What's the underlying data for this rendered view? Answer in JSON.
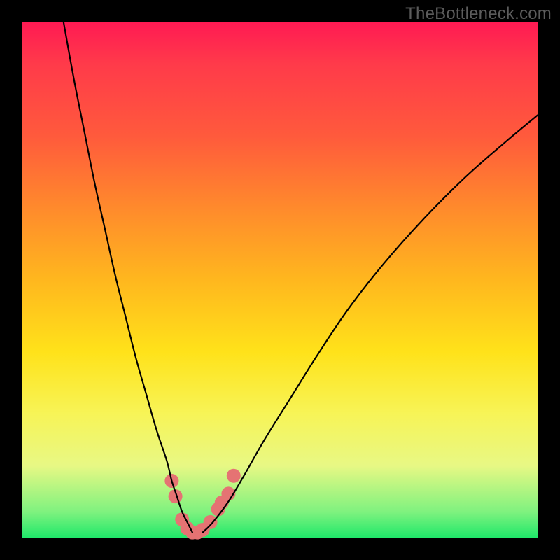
{
  "watermark": "TheBottleneck.com",
  "colors": {
    "background": "#000000",
    "curve_stroke": "#000000",
    "marker_fill": "#e57373"
  },
  "chart_data": {
    "type": "line",
    "title": "",
    "xlabel": "",
    "ylabel": "",
    "xlim": [
      0,
      100
    ],
    "ylim": [
      0,
      100
    ],
    "series": [
      {
        "name": "left-curve",
        "x": [
          8,
          10,
          12,
          14,
          16,
          18,
          20,
          22,
          24,
          26,
          28,
          29,
          30,
          31,
          32,
          33
        ],
        "values": [
          100,
          89,
          79,
          69,
          60,
          51,
          43,
          35,
          28,
          21,
          15,
          11,
          8,
          5,
          3,
          1
        ]
      },
      {
        "name": "right-curve",
        "x": [
          35,
          37,
          40,
          43,
          47,
          52,
          57,
          63,
          70,
          78,
          86,
          94,
          100
        ],
        "values": [
          1,
          3,
          7,
          12,
          19,
          27,
          35,
          44,
          53,
          62,
          70,
          77,
          82
        ]
      }
    ],
    "markers": [
      {
        "x": 29.0,
        "y": 11.0
      },
      {
        "x": 29.7,
        "y": 8.0
      },
      {
        "x": 31.0,
        "y": 3.5
      },
      {
        "x": 32.0,
        "y": 1.8
      },
      {
        "x": 33.0,
        "y": 1.0
      },
      {
        "x": 34.0,
        "y": 1.0
      },
      {
        "x": 35.0,
        "y": 1.5
      },
      {
        "x": 36.5,
        "y": 3.0
      },
      {
        "x": 38.0,
        "y": 5.5
      },
      {
        "x": 38.7,
        "y": 6.8
      },
      {
        "x": 40.0,
        "y": 8.5
      },
      {
        "x": 41.0,
        "y": 12.0
      }
    ],
    "marker_radius": 10
  }
}
